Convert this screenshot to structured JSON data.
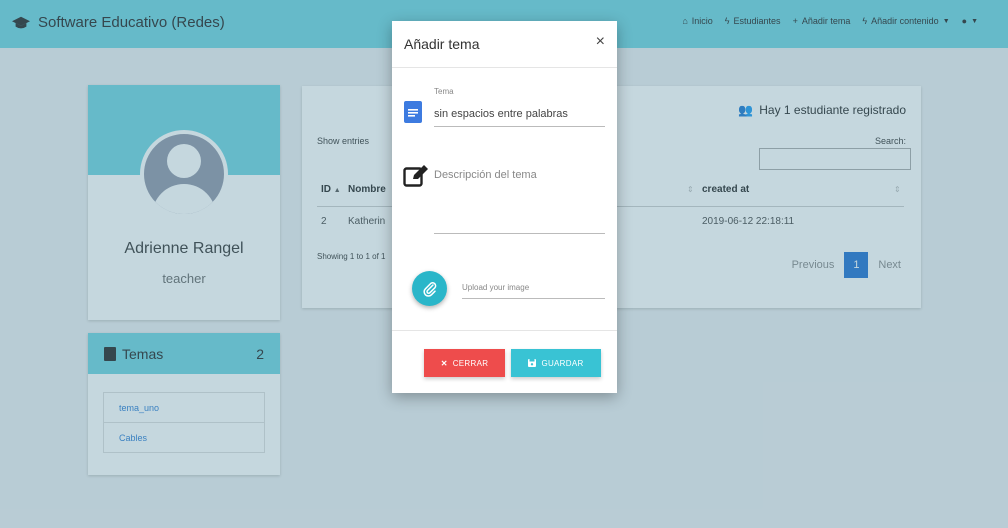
{
  "colors": {
    "accent": "#6ed3df",
    "primary": "#1e6fd1",
    "danger": "#ee4c4c",
    "info": "#39c3d4"
  },
  "navbar": {
    "brand": "Software Educativo (Redes)",
    "items": [
      {
        "icon": "home-icon",
        "label": "Inicio"
      },
      {
        "icon": "bolt-icon",
        "label": "Estudiantes"
      },
      {
        "icon": "plus-icon",
        "label": "Añadir tema"
      },
      {
        "icon": "bolt-icon",
        "label": "Añadir contenido"
      }
    ]
  },
  "profile": {
    "name": "Adrienne Rangel",
    "role": "teacher"
  },
  "temas": {
    "title": "Temas",
    "count": "2",
    "items": [
      "tema_uno",
      "Cables"
    ]
  },
  "table": {
    "registered": "Hay 1 estudiante registrado",
    "show_entries": "Show entries",
    "search_label": "Search:",
    "columns": [
      "ID",
      "Nombre",
      "created at"
    ],
    "rows": [
      {
        "id": "2",
        "name": "Katherin",
        "created": "2019-06-12 22:18:11"
      }
    ],
    "info": "Showing 1 to 1 of 1",
    "pager": {
      "previous": "Previous",
      "page": "1",
      "next": "Next"
    }
  },
  "modal": {
    "title": "Añadir tema",
    "close": "×",
    "tema_label": "Tema",
    "tema_value": "sin espacios entre palabras",
    "descripcion_placeholder": "Descripción del tema",
    "upload_placeholder": "Upload your image",
    "btn_cerrar": "CERRAR",
    "btn_guardar": "GUARDAR"
  }
}
